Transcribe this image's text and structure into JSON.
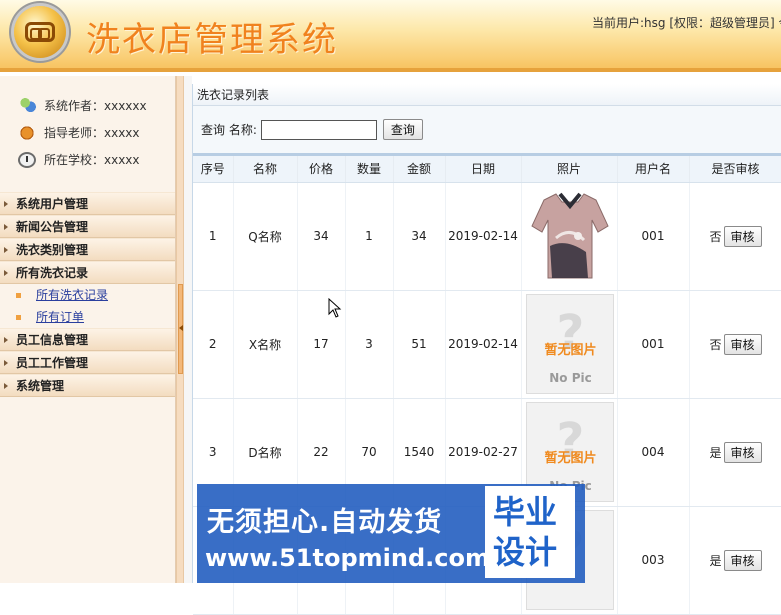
{
  "header": {
    "title": "洗衣店管理系统",
    "user_info": "当前用户:hsg [权限：超级管理员] 今"
  },
  "sidebar": {
    "info": [
      {
        "icon": "users-icon",
        "text": "系统作者：xxxxxx"
      },
      {
        "icon": "teacher-icon",
        "text": "指导老师：xxxxx"
      },
      {
        "icon": "clock-icon",
        "text": "所在学校：xxxxx"
      }
    ],
    "menu": [
      {
        "label": "系统用户管理"
      },
      {
        "label": "新闻公告管理"
      },
      {
        "label": "洗衣类别管理"
      },
      {
        "label": "所有洗衣记录",
        "children": [
          "所有洗衣记录",
          "所有订单"
        ]
      },
      {
        "label": "员工信息管理"
      },
      {
        "label": "员工工作管理"
      },
      {
        "label": "系统管理"
      }
    ]
  },
  "main": {
    "panel_title": "洗衣记录列表",
    "search": {
      "label": "查询 名称:",
      "value": "",
      "button": "查询"
    },
    "columns": [
      "序号",
      "名称",
      "价格",
      "数量",
      "金额",
      "日期",
      "照片",
      "用户名",
      "是否审核"
    ],
    "rows": [
      {
        "no": "1",
        "name": "Q名称",
        "price": "34",
        "qty": "1",
        "amount": "34",
        "date": "2019-02-14",
        "photo": "shirt",
        "user": "001",
        "approved": "否",
        "btn": "审核"
      },
      {
        "no": "2",
        "name": "X名称",
        "price": "17",
        "qty": "3",
        "amount": "51",
        "date": "2019-02-14",
        "photo": "nopic",
        "user": "001",
        "approved": "否",
        "btn": "审核"
      },
      {
        "no": "3",
        "name": "D名称",
        "price": "22",
        "qty": "70",
        "amount": "1540",
        "date": "2019-02-27",
        "photo": "nopic",
        "user": "004",
        "approved": "是",
        "btn": "审核"
      },
      {
        "no": "",
        "name": "",
        "price": "",
        "qty": "",
        "amount": "",
        "date": "",
        "photo": "nopic",
        "user": "003",
        "approved": "是",
        "btn": "审核"
      }
    ],
    "nopic": {
      "cn": "暂无图片",
      "en": "No Pic"
    }
  },
  "watermark": {
    "line1": "无须担心.自动发货",
    "line2": "www.51topmind.com",
    "badge": "毕业设计"
  }
}
